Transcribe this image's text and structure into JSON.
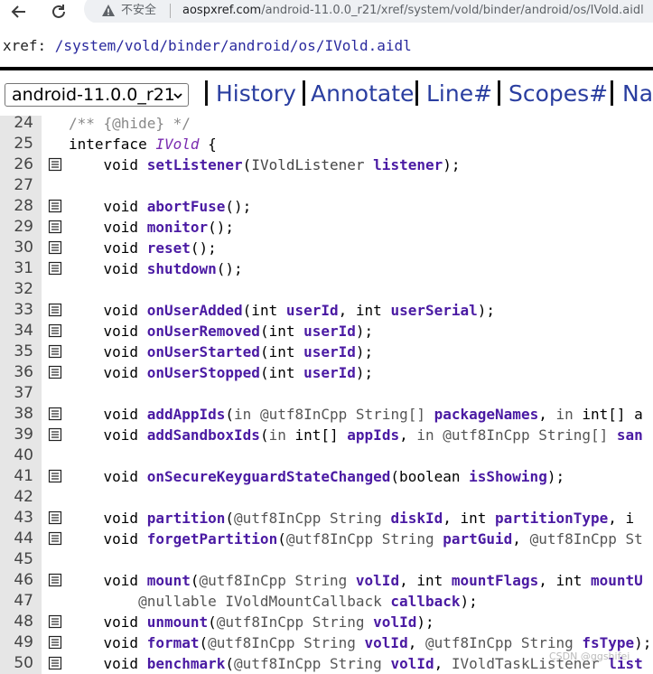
{
  "browser": {
    "back_icon": "arrow-left-icon",
    "reload_icon": "reload-icon",
    "insecure_label": "不安全",
    "url_host": "aospxref.com",
    "url_path": "/android-11.0.0_r21/xref/system/vold/binder/android/os/IVold.aidl"
  },
  "xref": {
    "label": "xref: ",
    "segments": [
      "/system",
      "/vold",
      "/binder",
      "/android",
      "/os",
      "/IVold.aidl"
    ]
  },
  "menu": {
    "version_select": "android-11.0.0_r21",
    "items": [
      "History",
      "Annotate",
      "Line#",
      "Scopes#",
      "Nav"
    ]
  },
  "code": {
    "lines": [
      {
        "n": "24",
        "fold": false,
        "parts": [
          [
            "cm",
            "/** {@hide} */"
          ]
        ]
      },
      {
        "n": "25",
        "fold": false,
        "parts": [
          [
            "kw",
            "interface "
          ],
          [
            "cls",
            "IVold"
          ],
          [
            "kw",
            " {"
          ]
        ]
      },
      {
        "n": "26",
        "fold": true,
        "parts": [
          [
            "kw",
            "    void "
          ],
          [
            "fn",
            "setListener"
          ],
          [
            "kw",
            "("
          ],
          [
            "ty",
            "IVoldListener "
          ],
          [
            "pm",
            "listener"
          ],
          [
            "kw",
            ");"
          ]
        ]
      },
      {
        "n": "27",
        "fold": false,
        "parts": []
      },
      {
        "n": "28",
        "fold": true,
        "parts": [
          [
            "kw",
            "    void "
          ],
          [
            "fn",
            "abortFuse"
          ],
          [
            "kw",
            "();"
          ]
        ]
      },
      {
        "n": "29",
        "fold": true,
        "parts": [
          [
            "kw",
            "    void "
          ],
          [
            "fn",
            "monitor"
          ],
          [
            "kw",
            "();"
          ]
        ]
      },
      {
        "n": "30",
        "fold": true,
        "parts": [
          [
            "kw",
            "    void "
          ],
          [
            "fn",
            "reset"
          ],
          [
            "kw",
            "();"
          ]
        ]
      },
      {
        "n": "31",
        "fold": true,
        "parts": [
          [
            "kw",
            "    void "
          ],
          [
            "fn",
            "shutdown"
          ],
          [
            "kw",
            "();"
          ]
        ]
      },
      {
        "n": "32",
        "fold": false,
        "parts": []
      },
      {
        "n": "33",
        "fold": true,
        "parts": [
          [
            "kw",
            "    void "
          ],
          [
            "fn",
            "onUserAdded"
          ],
          [
            "kw",
            "(int "
          ],
          [
            "pm",
            "userId"
          ],
          [
            "kw",
            ", int "
          ],
          [
            "pm",
            "userSerial"
          ],
          [
            "kw",
            ");"
          ]
        ]
      },
      {
        "n": "34",
        "fold": true,
        "parts": [
          [
            "kw",
            "    void "
          ],
          [
            "fn",
            "onUserRemoved"
          ],
          [
            "kw",
            "(int "
          ],
          [
            "pm",
            "userId"
          ],
          [
            "kw",
            ");"
          ]
        ]
      },
      {
        "n": "35",
        "fold": true,
        "parts": [
          [
            "kw",
            "    void "
          ],
          [
            "fn",
            "onUserStarted"
          ],
          [
            "kw",
            "(int "
          ],
          [
            "pm",
            "userId"
          ],
          [
            "kw",
            ");"
          ]
        ]
      },
      {
        "n": "36",
        "fold": true,
        "parts": [
          [
            "kw",
            "    void "
          ],
          [
            "fn",
            "onUserStopped"
          ],
          [
            "kw",
            "(int "
          ],
          [
            "pm",
            "userId"
          ],
          [
            "kw",
            ");"
          ]
        ]
      },
      {
        "n": "37",
        "fold": false,
        "parts": []
      },
      {
        "n": "38",
        "fold": true,
        "parts": [
          [
            "kw",
            "    void "
          ],
          [
            "fn",
            "addAppIds"
          ],
          [
            "kw",
            "("
          ],
          [
            "an",
            "in @utf8InCpp String[] "
          ],
          [
            "pm",
            "packageNames"
          ],
          [
            "kw",
            ", "
          ],
          [
            "an",
            "in "
          ],
          [
            "kw",
            "int[] a"
          ]
        ]
      },
      {
        "n": "39",
        "fold": true,
        "parts": [
          [
            "kw",
            "    void "
          ],
          [
            "fn",
            "addSandboxIds"
          ],
          [
            "kw",
            "("
          ],
          [
            "an",
            "in "
          ],
          [
            "kw",
            "int[] "
          ],
          [
            "pm",
            "appIds"
          ],
          [
            "kw",
            ", "
          ],
          [
            "an",
            "in @utf8InCpp String[] "
          ],
          [
            "pm",
            "san"
          ]
        ]
      },
      {
        "n": "40",
        "fold": false,
        "parts": []
      },
      {
        "n": "41",
        "fold": true,
        "parts": [
          [
            "kw",
            "    void "
          ],
          [
            "fn",
            "onSecureKeyguardStateChanged"
          ],
          [
            "kw",
            "(boolean "
          ],
          [
            "pm",
            "isShowing"
          ],
          [
            "kw",
            ");"
          ]
        ]
      },
      {
        "n": "42",
        "fold": false,
        "parts": []
      },
      {
        "n": "43",
        "fold": true,
        "parts": [
          [
            "kw",
            "    void "
          ],
          [
            "fn",
            "partition"
          ],
          [
            "kw",
            "("
          ],
          [
            "an",
            "@utf8InCpp String "
          ],
          [
            "pm",
            "diskId"
          ],
          [
            "kw",
            ", int "
          ],
          [
            "pm",
            "partitionType"
          ],
          [
            "kw",
            ", i"
          ]
        ]
      },
      {
        "n": "44",
        "fold": true,
        "parts": [
          [
            "kw",
            "    void "
          ],
          [
            "fn",
            "forgetPartition"
          ],
          [
            "kw",
            "("
          ],
          [
            "an",
            "@utf8InCpp String "
          ],
          [
            "pm",
            "partGuid"
          ],
          [
            "kw",
            ", "
          ],
          [
            "an",
            "@utf8InCpp St"
          ]
        ]
      },
      {
        "n": "45",
        "fold": false,
        "parts": []
      },
      {
        "n": "46",
        "fold": true,
        "parts": [
          [
            "kw",
            "    void "
          ],
          [
            "fn",
            "mount"
          ],
          [
            "kw",
            "("
          ],
          [
            "an",
            "@utf8InCpp String "
          ],
          [
            "pm",
            "volId"
          ],
          [
            "kw",
            ", int "
          ],
          [
            "pm",
            "mountFlags"
          ],
          [
            "kw",
            ", int "
          ],
          [
            "pm",
            "mountU"
          ]
        ]
      },
      {
        "n": "47",
        "fold": false,
        "parts": [
          [
            "kw",
            "        "
          ],
          [
            "an",
            "@nullable IVoldMountCallback "
          ],
          [
            "pm",
            "callback"
          ],
          [
            "kw",
            ");"
          ]
        ]
      },
      {
        "n": "48",
        "fold": true,
        "parts": [
          [
            "kw",
            "    void "
          ],
          [
            "fn",
            "unmount"
          ],
          [
            "kw",
            "("
          ],
          [
            "an",
            "@utf8InCpp String "
          ],
          [
            "pm",
            "volId"
          ],
          [
            "kw",
            ");"
          ]
        ]
      },
      {
        "n": "49",
        "fold": true,
        "parts": [
          [
            "kw",
            "    void "
          ],
          [
            "fn",
            "format"
          ],
          [
            "kw",
            "("
          ],
          [
            "an",
            "@utf8InCpp String "
          ],
          [
            "pm",
            "volId"
          ],
          [
            "kw",
            ", "
          ],
          [
            "an",
            "@utf8InCpp String "
          ],
          [
            "pm",
            "fsType"
          ],
          [
            "kw",
            ");"
          ]
        ]
      },
      {
        "n": "50",
        "fold": true,
        "parts": [
          [
            "kw",
            "    void "
          ],
          [
            "fn",
            "benchmark"
          ],
          [
            "kw",
            "("
          ],
          [
            "an",
            "@utf8InCpp String "
          ],
          [
            "pm",
            "volId"
          ],
          [
            "kw",
            ", "
          ],
          [
            "an",
            "IVoldTaskListener "
          ],
          [
            "pm",
            "list"
          ]
        ]
      }
    ]
  },
  "watermark": "CSDN @ggshifei"
}
